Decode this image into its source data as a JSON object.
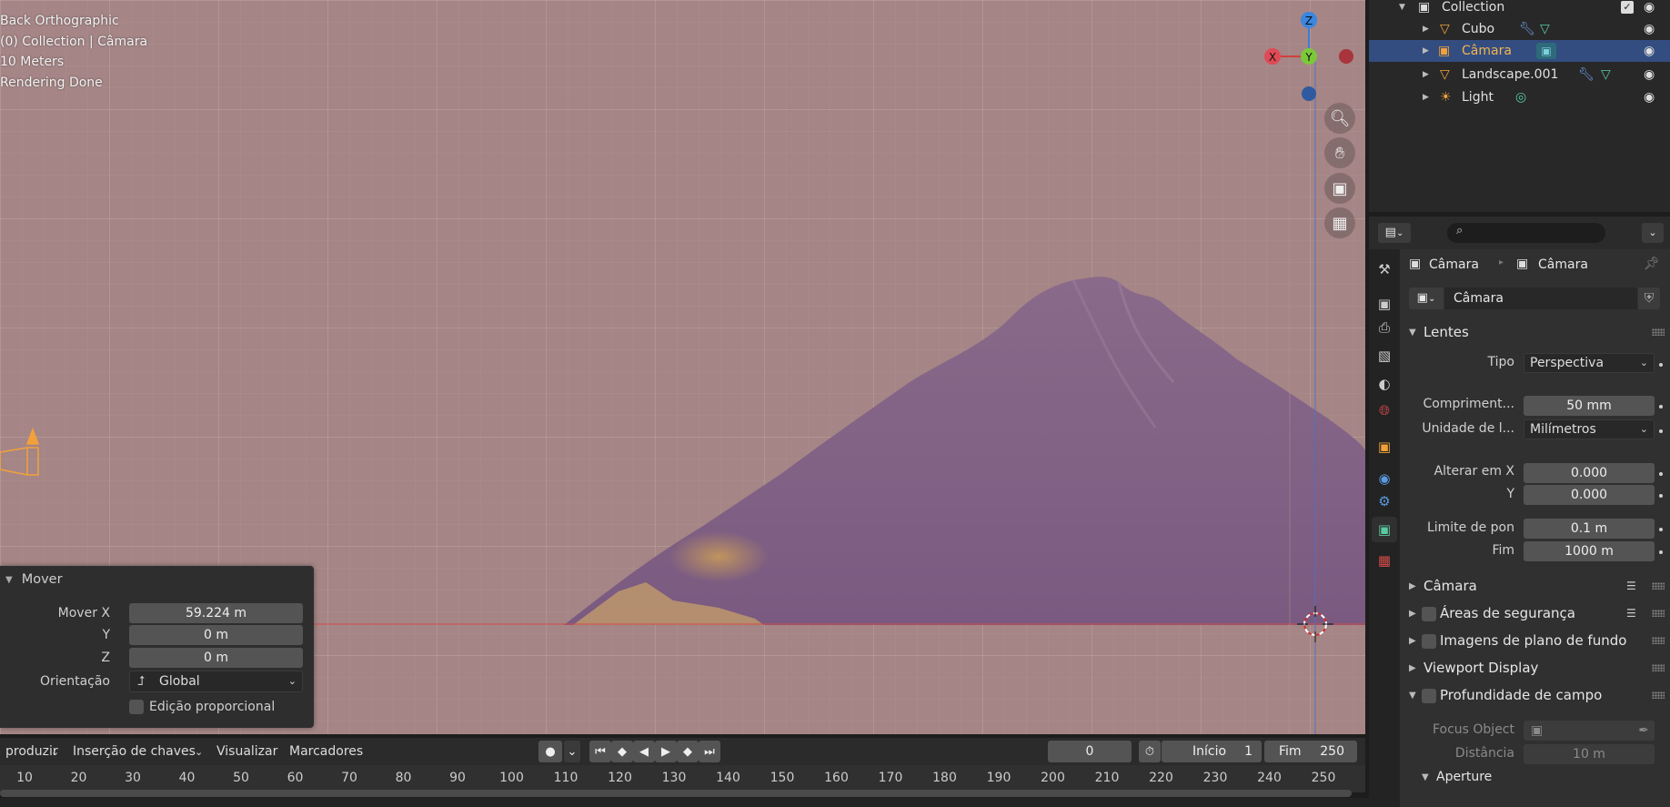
{
  "viewport": {
    "info_lines": [
      "Back Orthographic",
      "(0) Collection | Câmara",
      "10 Meters",
      "Rendering Done"
    ],
    "gizmo": {
      "z": "Z",
      "x": "X",
      "y": "Y"
    }
  },
  "operator_panel": {
    "title": "Mover",
    "mover_x_label": "Mover X",
    "mover_x": "59.224 m",
    "y_label": "Y",
    "y": "0 m",
    "z_label": "Z",
    "z": "0 m",
    "orientation_label": "Orientação",
    "orientation": "Global",
    "proportional_label": "Edição proporcional"
  },
  "timeline": {
    "menus": [
      "produzir",
      "Inserção de chaves",
      "Visualizar",
      "Marcadores"
    ],
    "current_frame": "0",
    "start_label": "Início",
    "start": "1",
    "end_label": "Fim",
    "end": "250",
    "ticks": [
      "10",
      "20",
      "30",
      "40",
      "50",
      "60",
      "70",
      "80",
      "90",
      "100",
      "110",
      "120",
      "130",
      "140",
      "150",
      "160",
      "170",
      "180",
      "190",
      "200",
      "210",
      "220",
      "230",
      "240",
      "250"
    ]
  },
  "outliner": {
    "collection": "Collection",
    "items": [
      {
        "name": "Cubo",
        "icon": "mesh-icon",
        "selected": false
      },
      {
        "name": "Câmara",
        "icon": "camera-icon",
        "selected": true
      },
      {
        "name": "Landscape.001",
        "icon": "mesh-icon",
        "selected": false
      },
      {
        "name": "Light",
        "icon": "light-icon",
        "selected": false
      }
    ]
  },
  "properties": {
    "breadcrumb_object": "Câmara",
    "breadcrumb_data": "Câmara",
    "datablock_name": "Câmara",
    "lens": {
      "title": "Lentes",
      "type_label": "Tipo",
      "type": "Perspectiva",
      "focal_label": "Compriment...",
      "focal": "50 mm",
      "unit_label": "Unidade de l...",
      "unit": "Milímetros",
      "shift_x_label": "Alterar em X",
      "shift_x": "0.000",
      "shift_y_label": "Y",
      "shift_y": "0.000",
      "clip_start_label": "Limite de pon",
      "clip_start": "0.1 m",
      "clip_end_label": "Fim",
      "clip_end": "1000 m"
    },
    "sections": {
      "camera": "Câmara",
      "safe_areas": "Áreas de segurança",
      "background_images": "Imagens de plano de fundo",
      "viewport_display": "Viewport Display",
      "dof": "Profundidade de campo"
    },
    "dof": {
      "focus_object_label": "Focus Object",
      "distance_label": "Distância",
      "distance": "10 m",
      "aperture": "Aperture"
    }
  }
}
